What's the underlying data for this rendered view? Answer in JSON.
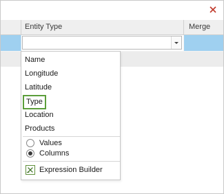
{
  "columns": {
    "entity_type": "Entity Type",
    "merge": "Merge"
  },
  "dropdown": {
    "items": [
      "Name",
      "Longitude",
      "Latitude",
      "Type",
      "Location",
      "Products"
    ],
    "selected_item": "Type",
    "options": [
      {
        "label": "Values",
        "checked": false
      },
      {
        "label": "Columns",
        "checked": true
      }
    ],
    "expression_builder": "Expression Builder"
  },
  "icons": {
    "close": "close-icon",
    "expression": "expression-builder-icon",
    "dropdown_arrow": "chevron-down-icon"
  },
  "colors": {
    "selected_row": "#9fd0f0",
    "highlight_border": "#5b9e3a",
    "close": "#c0392b"
  }
}
